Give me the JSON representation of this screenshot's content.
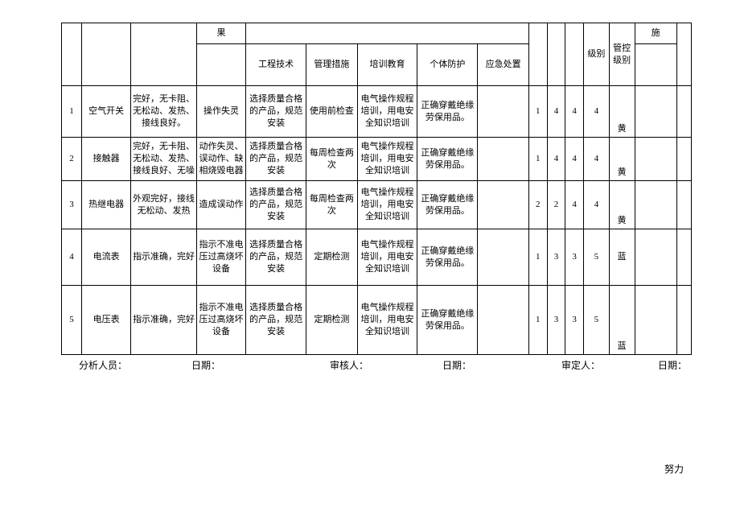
{
  "header": {
    "partial_top": "果",
    "eng": "工程技术",
    "mgmt": "管理措施",
    "train": "培训教育",
    "ppe": "个体防护",
    "emg": "应急处置",
    "lvl1": "级别",
    "lvl2": "管控级别",
    "meas": "施"
  },
  "rows": [
    {
      "idx": "1",
      "name": "空气开关",
      "chk": "完好，无卡阻、无松动、发热、接线良好。",
      "res": "操作失灵",
      "eng": "选择质量合格的产品，规范安装",
      "mgmt": "使用前检查",
      "train": "电气操作规程培训，用电安全知识培训",
      "ppe": "正确穿戴绝缘劳保用品。",
      "emg": "",
      "n1": "1",
      "n2": "4",
      "n3": "4",
      "lvl1": "4",
      "lvl2": "黄",
      "meas": ""
    },
    {
      "idx": "2",
      "name": "接触器",
      "chk": "完好，无卡阻、无松动、发热、接线良好、无噪",
      "res": "动作失灵、误动作、缺相烧毁电器",
      "eng": "选择质量合格的产品，规范安装",
      "mgmt": "每周检查两次",
      "train": "电气操作规程培训，用电安全知识培训",
      "ppe": "正确穿戴绝缘劳保用品。",
      "emg": "",
      "n1": "1",
      "n2": "4",
      "n3": "4",
      "lvl1": "4",
      "lvl2": "黄",
      "meas": ""
    },
    {
      "idx": "3",
      "name": "热继电器",
      "chk": "外观完好，接线无松动、发热",
      "res": "造成误动作",
      "eng": "选择质量合格的产品，规范安装",
      "mgmt": "每周检查两次",
      "train": "电气操作规程培训，用电安全知识培训",
      "ppe": "正确穿戴绝缘劳保用品。",
      "emg": "",
      "n1": "2",
      "n2": "2",
      "n3": "4",
      "lvl1": "4",
      "lvl2": "黄",
      "meas": ""
    },
    {
      "idx": "4",
      "name": "电流表",
      "chk": "指示准确，完好",
      "res": "指示不准电压过高烧坏设备",
      "eng": "选择质量合格的产品，规范安装",
      "mgmt": "定期检测",
      "train": "电气操作规程培训，用电安全知识培训",
      "ppe": "正确穿戴绝缘劳保用品。",
      "emg": "",
      "n1": "1",
      "n2": "3",
      "n3": "3",
      "lvl1": "5",
      "lvl2": "蓝",
      "meas": ""
    },
    {
      "idx": "5",
      "name": "电压表",
      "chk": "指示准确，完好",
      "res": "指示不准电压过高烧坏设备",
      "eng": "选择质量合格的产品，规范安装",
      "mgmt": "定期检测",
      "train": "电气操作规程培训，用电安全知识培训",
      "ppe": "正确穿戴绝缘劳保用品。",
      "emg": "",
      "n1": "1",
      "n2": "3",
      "n3": "3",
      "lvl1": "5",
      "lvl2": "蓝",
      "meas": ""
    }
  ],
  "footer": {
    "analyst": "分析人员：",
    "date1": "日期：",
    "reviewer": "审核人：",
    "date2": "日期：",
    "approver": "审定人：",
    "date3": "日期："
  },
  "effort": "努力"
}
